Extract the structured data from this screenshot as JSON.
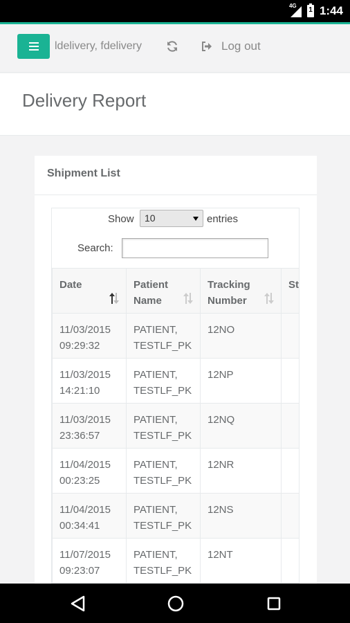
{
  "status_bar": {
    "network": "4G",
    "battery_level": "1",
    "time": "1:44"
  },
  "nav": {
    "user": "ldelivery, fdelivery",
    "logout_label": "Log out"
  },
  "page": {
    "title": "Delivery Report"
  },
  "card": {
    "title": "Shipment List"
  },
  "table_controls": {
    "show_label": "Show",
    "length_value": "10",
    "entries_label": "entries",
    "search_label": "Search:",
    "search_value": ""
  },
  "table": {
    "headers": [
      {
        "line1": "Date",
        "line2": ""
      },
      {
        "line1": "Patient",
        "line2": "Name"
      },
      {
        "line1": "Tracking",
        "line2": "Number"
      },
      {
        "line1": "St",
        "line2": ""
      }
    ],
    "rows": [
      {
        "date": "11/03/2015",
        "time": "09:29:32",
        "name1": "PATIENT,",
        "name2": "TESTLF_PK",
        "tracking": "12NO"
      },
      {
        "date": "11/03/2015",
        "time": "14:21:10",
        "name1": "PATIENT,",
        "name2": "TESTLF_PK",
        "tracking": "12NP"
      },
      {
        "date": "11/03/2015",
        "time": "23:36:57",
        "name1": "PATIENT,",
        "name2": "TESTLF_PK",
        "tracking": "12NQ"
      },
      {
        "date": "11/04/2015",
        "time": "00:23:25",
        "name1": "PATIENT,",
        "name2": "TESTLF_PK",
        "tracking": "12NR"
      },
      {
        "date": "11/04/2015",
        "time": "00:34:41",
        "name1": "PATIENT,",
        "name2": "TESTLF_PK",
        "tracking": "12NS"
      },
      {
        "date": "11/07/2015",
        "time": "09:23:07",
        "name1": "PATIENT,",
        "name2": "TESTLF_PK",
        "tracking": "12NT"
      }
    ]
  },
  "colors": {
    "accent": "#1ab394",
    "text": "#676a6c",
    "nav_text": "#888888"
  }
}
